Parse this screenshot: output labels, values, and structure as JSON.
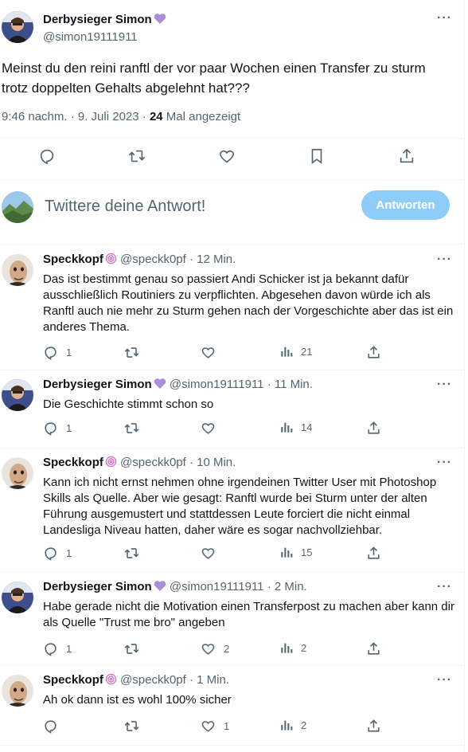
{
  "main_tweet": {
    "author_name": "Derbysieger Simon",
    "author_handle": "@simon19111911",
    "more": "···",
    "text": "Meinst du den reini ranftl der vor paar Wochen einen Transfer zu sturm trotz doppelten Gehalts abgelehnt hat???",
    "time": "9:46 nachm. · 9. Juli 2023 · ",
    "views_count": "24",
    "views_label": " Mal angezeigt",
    "icons": [
      "reply-icon",
      "retweet-icon",
      "like-icon",
      "bookmark-icon",
      "share-icon"
    ]
  },
  "compose": {
    "placeholder": "Twittere deine Antwort!",
    "button": "Antworten",
    "button_color": "#8ecdf8"
  },
  "replies": [
    {
      "name": "Speckkopf",
      "handle": "@speckk0pf",
      "time": " · 12 Min.",
      "text": "Das ist bestimmt genau so passiert Andi Schicker ist ja bekannt dafür ausschließlich Routiniers zu verpflichten. Abgesehen davon würde ich als Ranftl auch nie mehr zu Sturm gehen nach der Vorgeschichte aber das ist ein anderes Thema.",
      "replies": "1",
      "retweets": "",
      "likes": "",
      "views": "21"
    },
    {
      "name": "Derbysieger Simon",
      "handle": "@simon19111911",
      "time": " · 11 Min.",
      "text": "Die Geschichte stimmt schon so",
      "replies": "1",
      "retweets": "",
      "likes": "",
      "views": "14"
    },
    {
      "name": "Speckkopf",
      "handle": "@speckk0pf",
      "time": " · 10 Min.",
      "text": "Kann ich nicht ernst nehmen ohne irgendeinen Twitter User mit Photoshop Skills als Quelle. Aber wie gesagt: Ranftl wurde bei Sturm unter der alten Führung ausgemustert und stattdessen Leute forciert die nicht einmal Landesliga Niveau hatten, daher wäre es sogar nachvollziehbar.",
      "replies": "1",
      "retweets": "",
      "likes": "",
      "views": "15"
    },
    {
      "name": "Derbysieger Simon",
      "handle": "@simon19111911",
      "time": " · 2 Min.",
      "text": "Habe gerade nicht die Motivation einen Transferpost zu machen aber kann dir als Quelle \"Trust me bro\" angeben",
      "replies": "1",
      "retweets": "",
      "likes": "2",
      "views": "2"
    },
    {
      "name": "Speckkopf",
      "handle": "@speckk0pf",
      "time": " · 1 Min.",
      "text": "Ah ok dann ist es wohl 100% sicher",
      "replies": "",
      "retweets": "",
      "likes": "1",
      "views": "2"
    }
  ]
}
